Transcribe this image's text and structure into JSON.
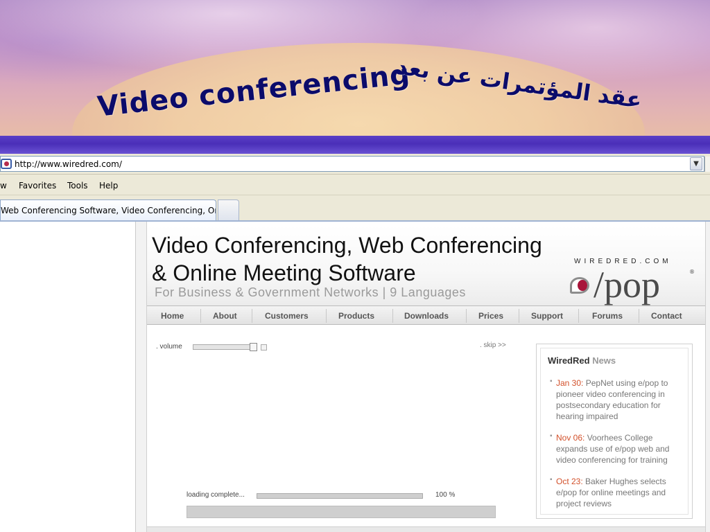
{
  "slide": {
    "title_en": "Video conferencing",
    "title_ar": "عقد المؤتمرات عن بعد",
    "title_color": "#0b0b6b",
    "accent_bar_color": "#4a2fb8"
  },
  "browser": {
    "address": "http://www.wiredred.com/",
    "menu": [
      "w",
      "Favorites",
      "Tools",
      "Help"
    ],
    "tab_title": "Web Conferencing Software, Video Conferencing, Onl..."
  },
  "site": {
    "headline_line1": "Video Conferencing, Web Conferencing",
    "headline_line2": "& Online Meeting Software",
    "subheadline": "For Business & Government Networks  |  9 Languages",
    "brand_small": "WIREDRED.COM",
    "brand_logo": "/pop",
    "brand_reg": "®",
    "nav": [
      "Home",
      "About",
      "Customers",
      "Products",
      "Downloads",
      "Prices",
      "Support",
      "Forums",
      "Contact"
    ],
    "player": {
      "volume_label": ". volume",
      "skip_label": ". skip >>",
      "loading_label": "loading complete...",
      "loading_percent_text": "100 %",
      "loading_progress": 1.0
    },
    "news": {
      "title_strong": "WiredRed",
      "title_muted": "News",
      "items": [
        {
          "date": "Jan 30:",
          "text": "PepNet using e/pop to pioneer video conferencing in postsecondary education for hearing impaired"
        },
        {
          "date": "Nov 06:",
          "text": "Voorhees College expands use of e/pop web and video conferencing for training"
        },
        {
          "date": "Oct 23:",
          "text": "Baker Hughes selects e/pop for online meetings and project reviews"
        }
      ],
      "date_color": "#d2502a"
    }
  }
}
